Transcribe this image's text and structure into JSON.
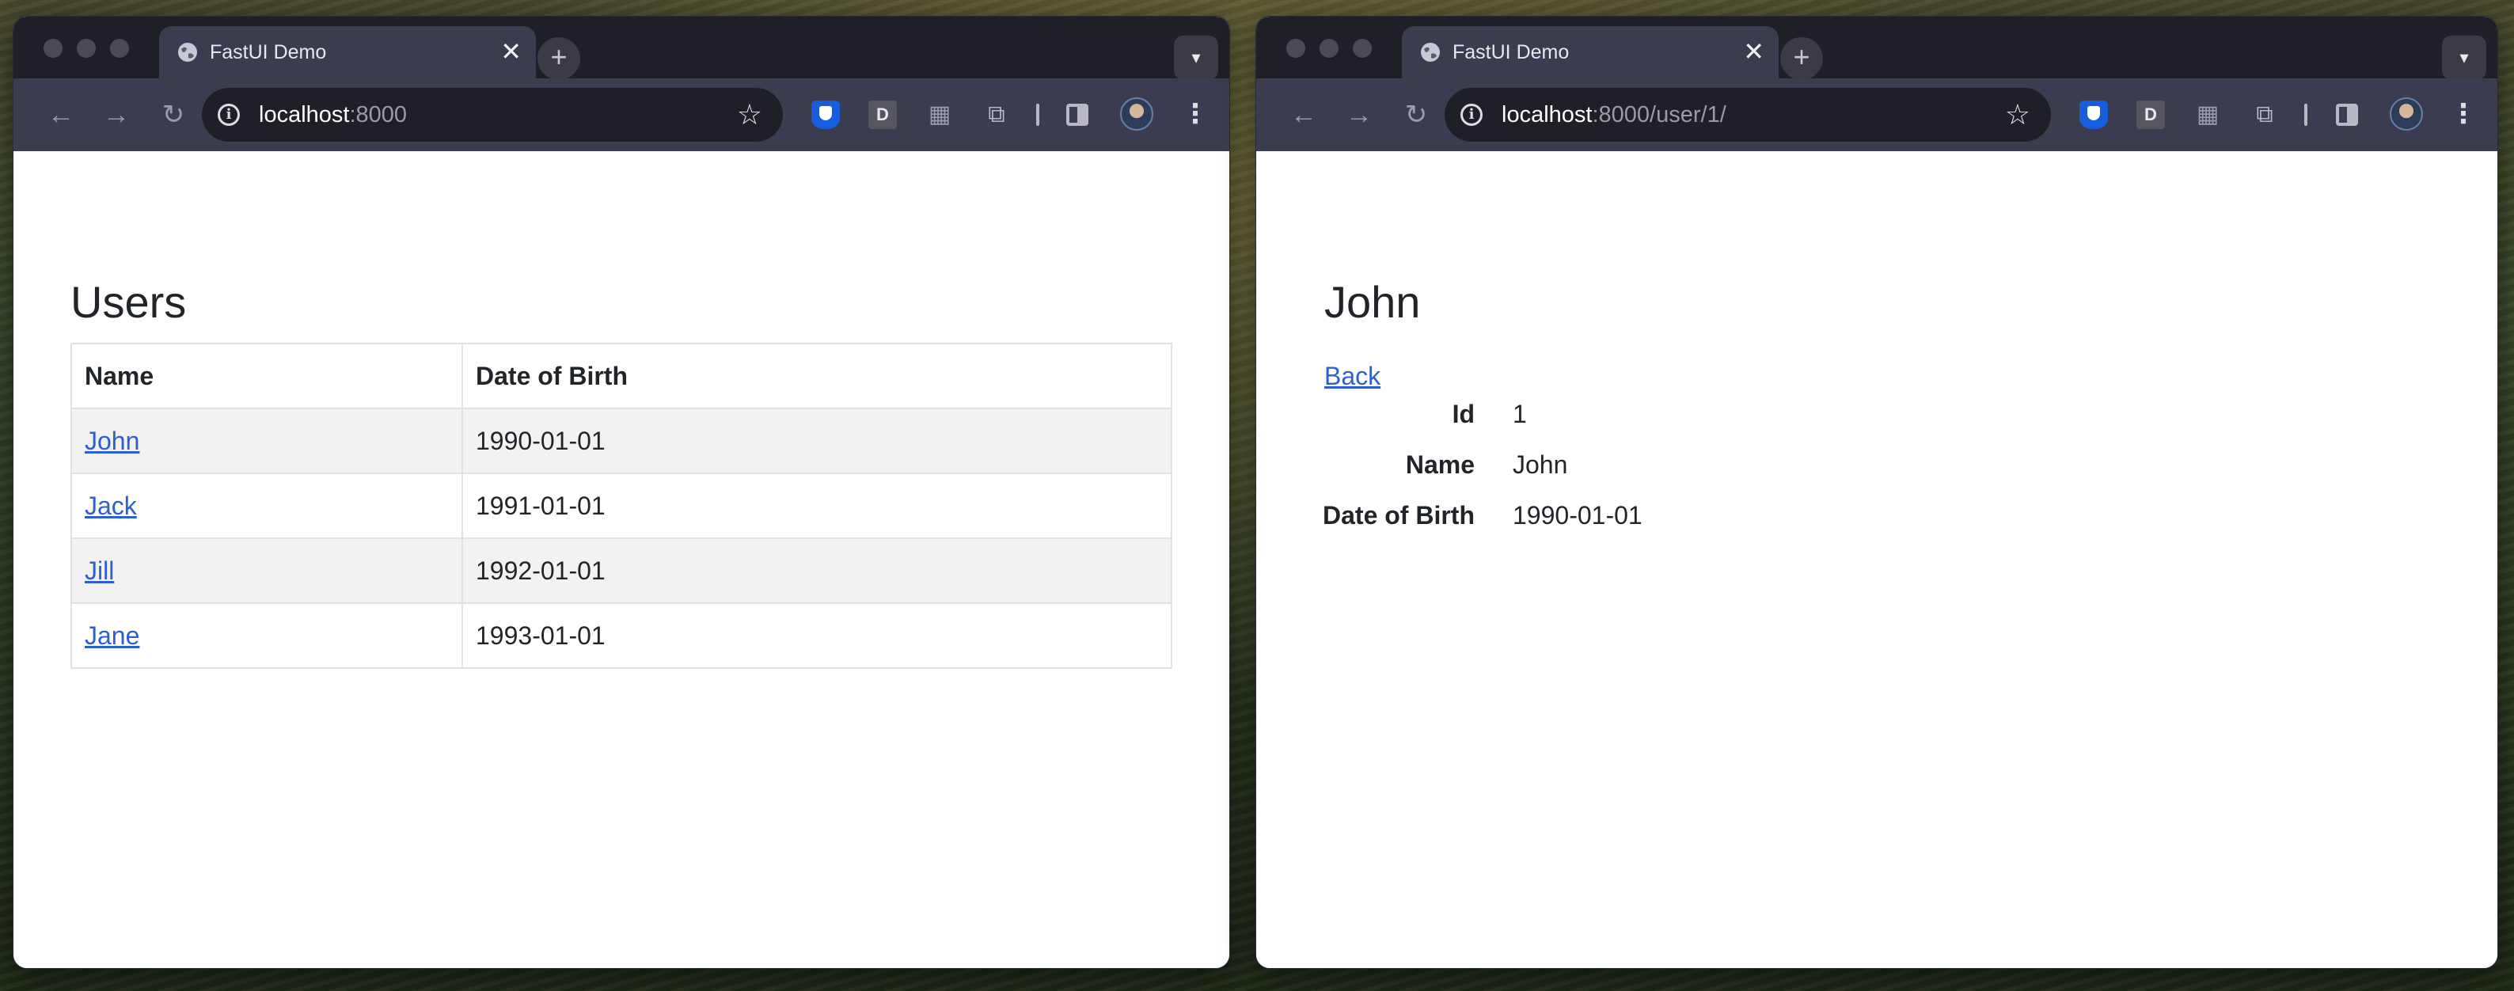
{
  "windows": [
    {
      "tab_title": "FastUI Demo",
      "url_host": "localhost",
      "url_rest": ":8000",
      "page": {
        "title": "Users",
        "columns": [
          "Name",
          "Date of Birth"
        ],
        "rows": [
          {
            "name": "John",
            "dob": "1990-01-01"
          },
          {
            "name": "Jack",
            "dob": "1991-01-01"
          },
          {
            "name": "Jill",
            "dob": "1992-01-01"
          },
          {
            "name": "Jane",
            "dob": "1993-01-01"
          }
        ]
      }
    },
    {
      "tab_title": "FastUI Demo",
      "url_host": "localhost",
      "url_rest": ":8000/user/1/",
      "page": {
        "title": "John",
        "back_label": "Back",
        "fields": [
          {
            "label": "Id",
            "value": "1"
          },
          {
            "label": "Name",
            "value": "John"
          },
          {
            "label": "Date of Birth",
            "value": "1990-01-01"
          }
        ]
      }
    }
  ],
  "browser": {
    "new_tab_glyph": "+",
    "close_glyph": "✕",
    "extensions": [
      "bitwarden-icon",
      "d-extension-icon",
      "qr-code-icon",
      "extensions-puzzle-icon",
      "side-panel-icon",
      "profile-avatar",
      "more-menu-icon"
    ],
    "d_ext_label": "D"
  },
  "colors": {
    "link": "#2e5fd0",
    "chrome_dark": "#1f2027",
    "chrome_toolbar": "#3b3c4f",
    "table_stripe": "#f2f2f2"
  }
}
